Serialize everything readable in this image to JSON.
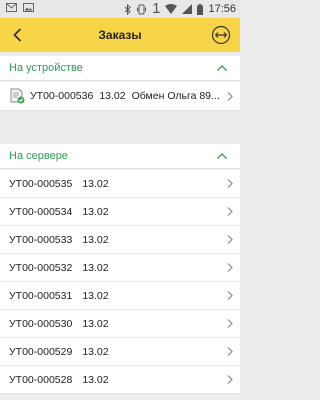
{
  "status_bar": {
    "sim_indicator": "1",
    "time": "17:56"
  },
  "app_bar": {
    "title": "Заказы"
  },
  "sections": {
    "device": {
      "label": "На устройстве",
      "items": [
        {
          "number": "УТ00-000536",
          "date": "13.02",
          "description": "Обмен Ольга 89..."
        }
      ]
    },
    "server": {
      "label": "На сервере",
      "items": [
        {
          "number": "УТ00-000535",
          "date": "13.02"
        },
        {
          "number": "УТ00-000534",
          "date": "13.02"
        },
        {
          "number": "УТ00-000533",
          "date": "13.02"
        },
        {
          "number": "УТ00-000532",
          "date": "13.02"
        },
        {
          "number": "УТ00-000531",
          "date": "13.02"
        },
        {
          "number": "УТ00-000530",
          "date": "13.02"
        },
        {
          "number": "УТ00-000529",
          "date": "13.02"
        },
        {
          "number": "УТ00-000528",
          "date": "13.02"
        }
      ]
    }
  },
  "colors": {
    "app_bar": "#f7d547",
    "section_label": "#2f9a57"
  }
}
